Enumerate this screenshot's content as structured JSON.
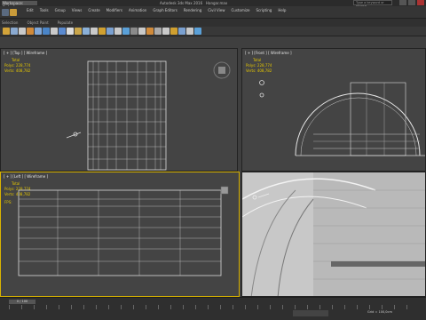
{
  "titlebar": {
    "workspace_label": "Workspace: Default",
    "app_title": "Autodesk 3ds Max 2016",
    "file_name": "Hangar.max",
    "search_placeholder": "Type a keyword or phrase"
  },
  "menubar": {
    "items": [
      "Edit",
      "Tools",
      "Group",
      "Views",
      "Create",
      "Modifiers",
      "Animation",
      "Graph Editors",
      "Rendering",
      "Civil View",
      "Customize",
      "Scripting",
      "Help"
    ],
    "view_dropdown": "View"
  },
  "ribbon": {
    "tabs": [
      "Selection",
      "Object Paint",
      "Populate"
    ]
  },
  "viewports": {
    "top": {
      "label": "[ + ] [Top ] [ Wireframe ]",
      "stats_total": "Total",
      "polys_label": "Polys:",
      "polys_value": "228,774",
      "verts_label": "Verts:",
      "verts_value": "408,782"
    },
    "front": {
      "label": "[ + ] [Front ] [ Wireframe ]",
      "stats_total": "Total",
      "polys_label": "Polys:",
      "polys_value": "228,774",
      "verts_label": "Verts:",
      "verts_value": "408,782"
    },
    "left": {
      "label": "[ + ] [Left ] [ Wireframe ]",
      "stats_total": "Total",
      "polys_label": "Polys:",
      "polys_value": "228,774",
      "verts_label": "Verts:",
      "verts_value": "408,782",
      "fps_label": "FPS:"
    },
    "perspective": {
      "label": ""
    }
  },
  "statusbar": {
    "frame_counter": "0 / 100",
    "grid_label": "Grid = 100,0cm"
  },
  "colors": {
    "accent_yellow": "#e2c400",
    "viewport_bg": "#444444",
    "active_border": "#d9b300"
  }
}
